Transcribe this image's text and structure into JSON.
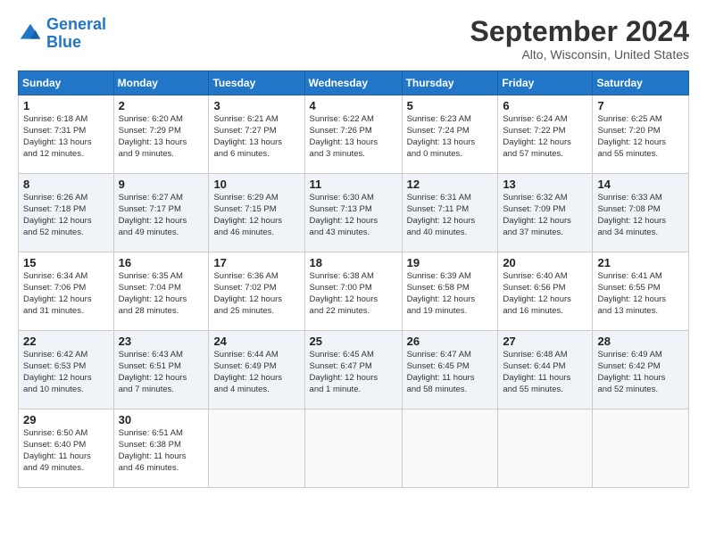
{
  "header": {
    "logo_line1": "General",
    "logo_line2": "Blue",
    "month_title": "September 2024",
    "location": "Alto, Wisconsin, United States"
  },
  "days_of_week": [
    "Sunday",
    "Monday",
    "Tuesday",
    "Wednesday",
    "Thursday",
    "Friday",
    "Saturday"
  ],
  "weeks": [
    [
      {
        "day": "1",
        "info": "Sunrise: 6:18 AM\nSunset: 7:31 PM\nDaylight: 13 hours\nand 12 minutes."
      },
      {
        "day": "2",
        "info": "Sunrise: 6:20 AM\nSunset: 7:29 PM\nDaylight: 13 hours\nand 9 minutes."
      },
      {
        "day": "3",
        "info": "Sunrise: 6:21 AM\nSunset: 7:27 PM\nDaylight: 13 hours\nand 6 minutes."
      },
      {
        "day": "4",
        "info": "Sunrise: 6:22 AM\nSunset: 7:26 PM\nDaylight: 13 hours\nand 3 minutes."
      },
      {
        "day": "5",
        "info": "Sunrise: 6:23 AM\nSunset: 7:24 PM\nDaylight: 13 hours\nand 0 minutes."
      },
      {
        "day": "6",
        "info": "Sunrise: 6:24 AM\nSunset: 7:22 PM\nDaylight: 12 hours\nand 57 minutes."
      },
      {
        "day": "7",
        "info": "Sunrise: 6:25 AM\nSunset: 7:20 PM\nDaylight: 12 hours\nand 55 minutes."
      }
    ],
    [
      {
        "day": "8",
        "info": "Sunrise: 6:26 AM\nSunset: 7:18 PM\nDaylight: 12 hours\nand 52 minutes."
      },
      {
        "day": "9",
        "info": "Sunrise: 6:27 AM\nSunset: 7:17 PM\nDaylight: 12 hours\nand 49 minutes."
      },
      {
        "day": "10",
        "info": "Sunrise: 6:29 AM\nSunset: 7:15 PM\nDaylight: 12 hours\nand 46 minutes."
      },
      {
        "day": "11",
        "info": "Sunrise: 6:30 AM\nSunset: 7:13 PM\nDaylight: 12 hours\nand 43 minutes."
      },
      {
        "day": "12",
        "info": "Sunrise: 6:31 AM\nSunset: 7:11 PM\nDaylight: 12 hours\nand 40 minutes."
      },
      {
        "day": "13",
        "info": "Sunrise: 6:32 AM\nSunset: 7:09 PM\nDaylight: 12 hours\nand 37 minutes."
      },
      {
        "day": "14",
        "info": "Sunrise: 6:33 AM\nSunset: 7:08 PM\nDaylight: 12 hours\nand 34 minutes."
      }
    ],
    [
      {
        "day": "15",
        "info": "Sunrise: 6:34 AM\nSunset: 7:06 PM\nDaylight: 12 hours\nand 31 minutes."
      },
      {
        "day": "16",
        "info": "Sunrise: 6:35 AM\nSunset: 7:04 PM\nDaylight: 12 hours\nand 28 minutes."
      },
      {
        "day": "17",
        "info": "Sunrise: 6:36 AM\nSunset: 7:02 PM\nDaylight: 12 hours\nand 25 minutes."
      },
      {
        "day": "18",
        "info": "Sunrise: 6:38 AM\nSunset: 7:00 PM\nDaylight: 12 hours\nand 22 minutes."
      },
      {
        "day": "19",
        "info": "Sunrise: 6:39 AM\nSunset: 6:58 PM\nDaylight: 12 hours\nand 19 minutes."
      },
      {
        "day": "20",
        "info": "Sunrise: 6:40 AM\nSunset: 6:56 PM\nDaylight: 12 hours\nand 16 minutes."
      },
      {
        "day": "21",
        "info": "Sunrise: 6:41 AM\nSunset: 6:55 PM\nDaylight: 12 hours\nand 13 minutes."
      }
    ],
    [
      {
        "day": "22",
        "info": "Sunrise: 6:42 AM\nSunset: 6:53 PM\nDaylight: 12 hours\nand 10 minutes."
      },
      {
        "day": "23",
        "info": "Sunrise: 6:43 AM\nSunset: 6:51 PM\nDaylight: 12 hours\nand 7 minutes."
      },
      {
        "day": "24",
        "info": "Sunrise: 6:44 AM\nSunset: 6:49 PM\nDaylight: 12 hours\nand 4 minutes."
      },
      {
        "day": "25",
        "info": "Sunrise: 6:45 AM\nSunset: 6:47 PM\nDaylight: 12 hours\nand 1 minute."
      },
      {
        "day": "26",
        "info": "Sunrise: 6:47 AM\nSunset: 6:45 PM\nDaylight: 11 hours\nand 58 minutes."
      },
      {
        "day": "27",
        "info": "Sunrise: 6:48 AM\nSunset: 6:44 PM\nDaylight: 11 hours\nand 55 minutes."
      },
      {
        "day": "28",
        "info": "Sunrise: 6:49 AM\nSunset: 6:42 PM\nDaylight: 11 hours\nand 52 minutes."
      }
    ],
    [
      {
        "day": "29",
        "info": "Sunrise: 6:50 AM\nSunset: 6:40 PM\nDaylight: 11 hours\nand 49 minutes."
      },
      {
        "day": "30",
        "info": "Sunrise: 6:51 AM\nSunset: 6:38 PM\nDaylight: 11 hours\nand 46 minutes."
      },
      {
        "day": "",
        "info": ""
      },
      {
        "day": "",
        "info": ""
      },
      {
        "day": "",
        "info": ""
      },
      {
        "day": "",
        "info": ""
      },
      {
        "day": "",
        "info": ""
      }
    ]
  ]
}
